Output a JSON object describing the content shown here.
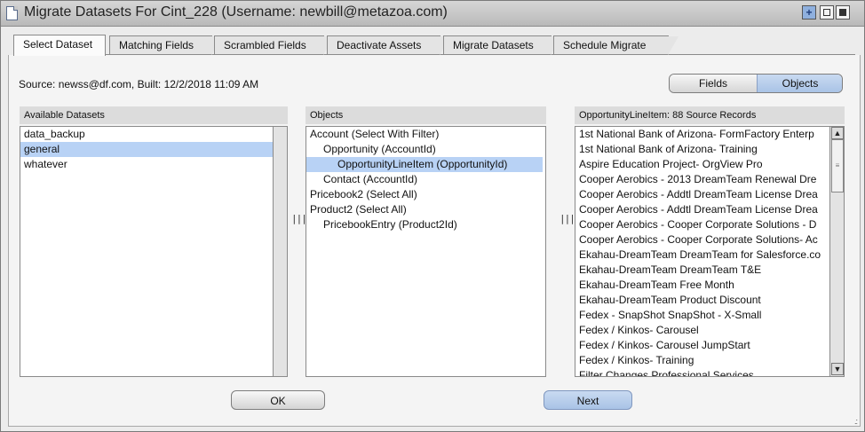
{
  "window": {
    "title": "Migrate Datasets For Cint_228 (Username: newbill@metazoa.com)"
  },
  "tabs": [
    {
      "label": "Select Dataset",
      "active": true
    },
    {
      "label": "Matching Fields"
    },
    {
      "label": "Scrambled Fields"
    },
    {
      "label": "Deactivate Assets"
    },
    {
      "label": "Migrate Datasets"
    },
    {
      "label": "Schedule Migrate"
    }
  ],
  "source_line": "Source: newss@df.com, Built: 12/2/2018 11:09 AM",
  "toggle": {
    "fields": "Fields",
    "objects": "Objects",
    "selected": "Objects"
  },
  "datasets_panel": {
    "header": "Available Datasets",
    "items": [
      "data_backup",
      "general",
      "whatever"
    ],
    "selected": "general"
  },
  "objects_panel": {
    "header": "Objects",
    "items": [
      "Account (Select With Filter)",
      "Opportunity (AccountId)",
      "OpportunityLineItem (OpportunityId)",
      "Contact (AccountId)",
      "Pricebook2 (Select All)",
      "Product2 (Select All)",
      "PricebookEntry (Product2Id)"
    ],
    "selected": "OpportunityLineItem (OpportunityId)"
  },
  "records_panel": {
    "header": "OpportunityLineItem: 88 Source Records",
    "items": [
      "1st National Bank of Arizona- FormFactory Enterp",
      "1st National Bank of Arizona- Training",
      "Aspire Education Project- OrgView Pro",
      "Cooper Aerobics - 2013 DreamTeam Renewal Dre",
      "Cooper Aerobics - Addtl DreamTeam License Drea",
      "Cooper Aerobics - Addtl DreamTeam License Drea",
      "Cooper Aerobics - Cooper Corporate Solutions - D",
      "Cooper Aerobics - Cooper Corporate Solutions- Ac",
      "Ekahau-DreamTeam DreamTeam for Salesforce.co",
      "Ekahau-DreamTeam DreamTeam T&E",
      "Ekahau-DreamTeam Free Month",
      "Ekahau-DreamTeam Product Discount",
      "Fedex - SnapShot SnapShot - X-Small",
      "Fedex / Kinkos- Carousel",
      "Fedex / Kinkos- Carousel JumpStart",
      "Fedex / Kinkos- Training",
      "Filter Changes Professional Services"
    ]
  },
  "buttons": {
    "ok": "OK",
    "next": "Next"
  },
  "colors": {
    "selection": "#b8d2f5",
    "accent": "#a9c3e6"
  }
}
